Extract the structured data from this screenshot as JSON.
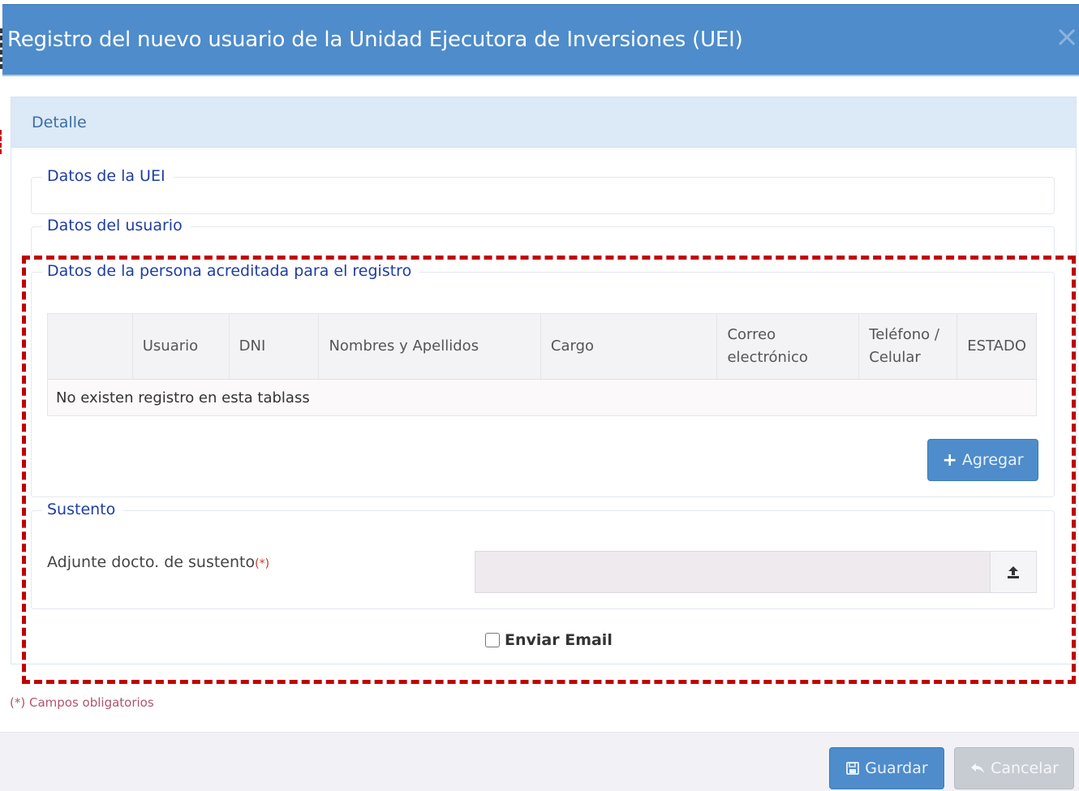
{
  "modal": {
    "title": "Registro del nuevo usuario de la Unidad Ejecutora de Inversiones (UEI)",
    "close_symbol": "×"
  },
  "panel": {
    "title": "Detalle"
  },
  "sections": {
    "uei": "Datos de la UEI",
    "usuario": "Datos del usuario",
    "persona": "Datos de la persona acreditada para el registro",
    "sustento": "Sustento"
  },
  "table": {
    "columns": [
      "",
      "Usuario",
      "DNI",
      "Nombres y Apellidos",
      "Cargo",
      "Correo electrónico",
      "Teléfono / Celular",
      "ESTADO"
    ],
    "empty_message": "No existen registro en esta tablass"
  },
  "buttons": {
    "agregar": "Agregar",
    "guardar": "Guardar",
    "cancelar": "Cancelar"
  },
  "sustento": {
    "label": "Adjunte docto. de sustento",
    "required_mark": "(*)",
    "file_value": ""
  },
  "email": {
    "label": "Enviar Email",
    "checked": false
  },
  "footer_note": "(*) Campos obligatorios",
  "colors": {
    "primary": "#4e8ccb",
    "header_panel": "#dce9f7",
    "legend": "#1e3da3",
    "highlight": "#c00000",
    "disabled_button": "#c7ccd3"
  }
}
